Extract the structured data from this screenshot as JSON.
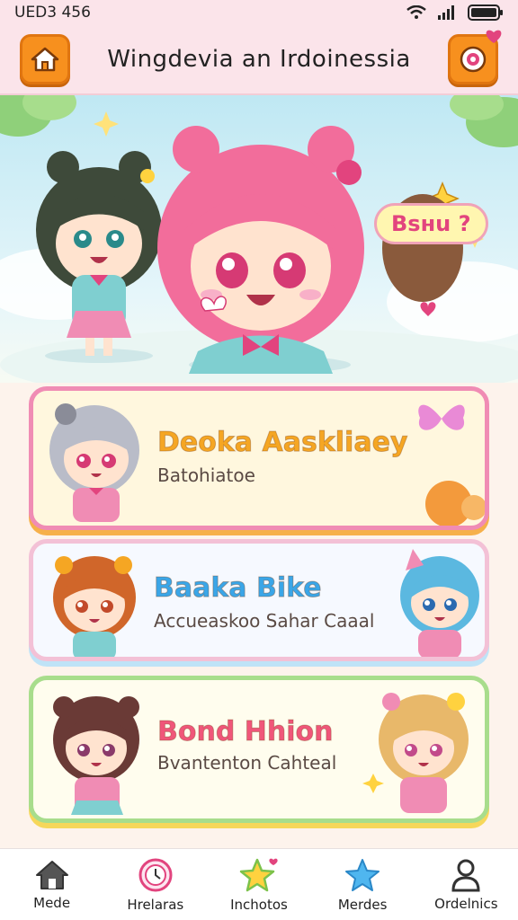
{
  "status_bar": {
    "time": "UED3 456"
  },
  "header": {
    "title": "Wingdevia  an Irdoinessia"
  },
  "hero": {
    "speech_bubble": "Bsнu ?"
  },
  "cards": [
    {
      "title": "Deoka Aaskliaey",
      "subtitle": "Batohiatoe",
      "title_color": "#f5a623"
    },
    {
      "title": "Baaka Bike",
      "subtitle": "Accueaskoo Sahar Caaal",
      "title_color": "#3aa6e8"
    },
    {
      "title": "Bond Hhion",
      "subtitle": "Bvantenton Cahteal",
      "title_color": "#f0567a"
    }
  ],
  "bottom_nav": [
    {
      "label": "Mede",
      "icon": "home-icon"
    },
    {
      "label": "Hrelaras",
      "icon": "clock-icon"
    },
    {
      "label": "Inchotos",
      "icon": "star-icon"
    },
    {
      "label": "Merdes",
      "icon": "star-icon"
    },
    {
      "label": "Ordelnics",
      "icon": "profile-icon"
    }
  ]
}
